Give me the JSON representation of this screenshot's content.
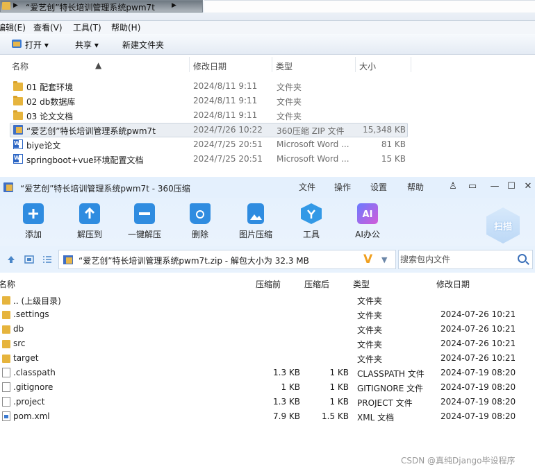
{
  "explorer": {
    "breadcrumb": "“爱艺创”特长培训管理系统pwm7t",
    "menu": [
      "编辑(E)",
      "查看(V)",
      "工具(T)",
      "帮助(H)"
    ],
    "toolbar": {
      "open": "打开",
      "share": "共享",
      "new_folder": "新建文件夹"
    },
    "columns": {
      "name": "名称",
      "date": "修改日期",
      "type": "类型",
      "size": "大小"
    },
    "rows": [
      {
        "name": "01 配套环境",
        "date": "2024/8/11 9:11",
        "type": "文件夹",
        "size": "",
        "icon": "folder-icon"
      },
      {
        "name": "02 db数据库",
        "date": "2024/8/11 9:11",
        "type": "文件夹",
        "size": "",
        "icon": "folder-icon"
      },
      {
        "name": "03 论文文档",
        "date": "2024/8/11 9:11",
        "type": "文件夹",
        "size": "",
        "icon": "folder-icon"
      },
      {
        "name": "“爱艺创”特长培训管理系统pwm7t",
        "date": "2024/7/26 10:22",
        "type": "360压缩 ZIP 文件",
        "size": "15,348 KB",
        "icon": "zip-icon"
      },
      {
        "name": "biye论文",
        "date": "2024/7/25 20:51",
        "type": "Microsoft Word ...",
        "size": "81 KB",
        "icon": "word-icon"
      },
      {
        "name": "springboot+vue环境配置文档",
        "date": "2024/7/25 20:51",
        "type": "Microsoft Word ...",
        "size": "15 KB",
        "icon": "word-icon"
      }
    ]
  },
  "zip": {
    "title": "“爱艺创”特长培训管理系统pwm7t - 360压缩",
    "menu": [
      "文件",
      "操作",
      "设置",
      "帮助"
    ],
    "ribbon": [
      {
        "label": "添加",
        "icon": "add-icon"
      },
      {
        "label": "解压到",
        "icon": "extract-to-icon"
      },
      {
        "label": "一键解压",
        "icon": "one-click-extract-icon"
      },
      {
        "label": "删除",
        "icon": "delete-icon"
      },
      {
        "label": "图片压缩",
        "icon": "image-compress-icon"
      },
      {
        "label": "工具",
        "icon": "tools-icon"
      },
      {
        "label": "AI办公",
        "icon": "ai-office-icon"
      }
    ],
    "scan": "扫描",
    "path": "“爱艺创”特长培训管理系统pwm7t.zip - 解包大小为 32.3 MB",
    "search_placeholder": "搜索包内文件",
    "columns": {
      "name": "名称",
      "packed": "压缩前",
      "compressed": "压缩后",
      "type": "类型",
      "date": "修改日期"
    },
    "rows": [
      {
        "name": ".. (上级目录)",
        "packed": "",
        "compressed": "",
        "type": "文件夹",
        "date": "",
        "icon": "folder-icon"
      },
      {
        "name": ".settings",
        "packed": "",
        "compressed": "",
        "type": "文件夹",
        "date": "2024-07-26 10:21",
        "icon": "folder-icon"
      },
      {
        "name": "db",
        "packed": "",
        "compressed": "",
        "type": "文件夹",
        "date": "2024-07-26 10:21",
        "icon": "folder-icon"
      },
      {
        "name": "src",
        "packed": "",
        "compressed": "",
        "type": "文件夹",
        "date": "2024-07-26 10:21",
        "icon": "folder-icon"
      },
      {
        "name": "target",
        "packed": "",
        "compressed": "",
        "type": "文件夹",
        "date": "2024-07-26 10:21",
        "icon": "folder-icon"
      },
      {
        "name": ".classpath",
        "packed": "1.3 KB",
        "compressed": "1 KB",
        "type": "CLASSPATH 文件",
        "date": "2024-07-19 08:20",
        "icon": "file-icon"
      },
      {
        "name": ".gitignore",
        "packed": "1 KB",
        "compressed": "1 KB",
        "type": "GITIGNORE 文件",
        "date": "2024-07-19 08:20",
        "icon": "file-icon"
      },
      {
        "name": ".project",
        "packed": "1.3 KB",
        "compressed": "1 KB",
        "type": "PROJECT 文件",
        "date": "2024-07-19 08:20",
        "icon": "file-icon"
      },
      {
        "name": "pom.xml",
        "packed": "7.9 KB",
        "compressed": "1.5 KB",
        "type": "XML 文档",
        "date": "2024-07-19 08:20",
        "icon": "xml-file-icon"
      }
    ]
  },
  "watermark": "CSDN @真纯Django毕设程序"
}
